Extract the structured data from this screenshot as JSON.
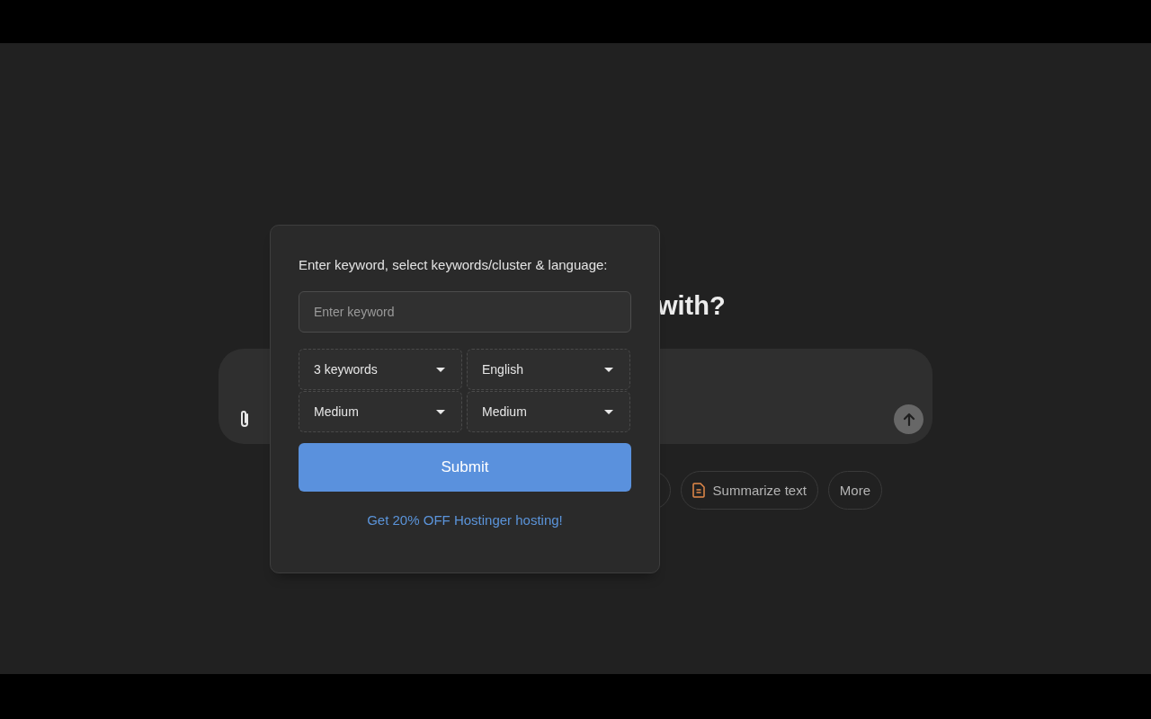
{
  "heading": "with?",
  "chips": [
    {
      "kind": "blank"
    },
    {
      "kind": "icon",
      "label": "Summarize text"
    },
    {
      "kind": "text",
      "label": "More"
    }
  ],
  "modal": {
    "title": "Enter keyword, select keywords/cluster & language:",
    "keyword_field": {
      "placeholder": "Enter keyword"
    },
    "selects": [
      {
        "value": "3 keywords"
      },
      {
        "value": "English"
      },
      {
        "value": "Medium"
      },
      {
        "value": "Medium"
      }
    ],
    "submit": "Submit",
    "promo_link": "Get 20% OFF Hostinger hosting!"
  }
}
